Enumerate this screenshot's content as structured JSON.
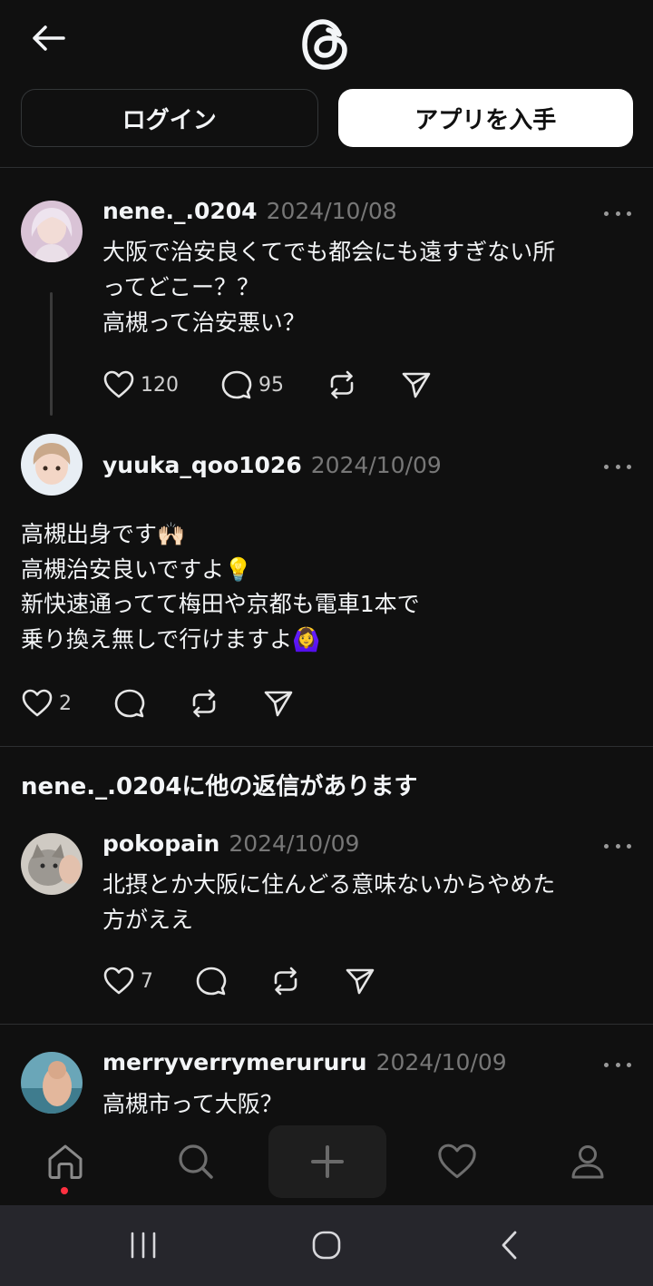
{
  "header": {
    "back_icon": "arrow-left-icon",
    "logo_icon": "threads-logo-icon",
    "login_label": "ログイン",
    "get_app_label": "アプリを入手"
  },
  "posts": [
    {
      "username": "nene._.0204",
      "date": "2024/10/08",
      "text": "大阪で治安良くてでも都会にも遠すぎない所\nってどこー？？\n高槻って治安悪い？",
      "likes": "120",
      "replies": "95"
    },
    {
      "username": "yuuka_qoo1026",
      "date": "2024/10/09",
      "text": "高槻出身です🙌🏻\n高槻治安良いですよ💡\n新快速通ってて梅田や京都も電車1本で\n乗り換え無しで行けますよ🙆‍♀️",
      "likes": "2",
      "replies": ""
    }
  ],
  "more_replies_heading": "nene._.0204に他の返信があります",
  "replies": [
    {
      "username": "pokopain",
      "date": "2024/10/09",
      "text": "北摂とか大阪に住んどる意味ないからやめた\n方がええ",
      "likes": "7",
      "replies": ""
    },
    {
      "username": "merryverrymerururu",
      "date": "2024/10/09",
      "text": "高槻市って大阪？",
      "likes": "",
      "replies": ""
    }
  ],
  "bottom_nav": [
    "home-icon",
    "search-icon",
    "compose-plus-icon",
    "heart-icon",
    "profile-icon"
  ],
  "system_nav": [
    "recent-apps-icon",
    "home-circle-icon",
    "back-chevron-icon"
  ],
  "colors": {
    "background": "#101010",
    "text": "#f3f5f7",
    "muted": "#777777",
    "notification_dot": "#ff3040"
  }
}
